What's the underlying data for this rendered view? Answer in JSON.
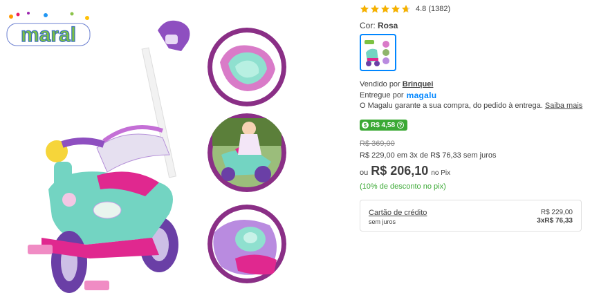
{
  "brand_logo": {
    "text": "maral"
  },
  "product": {
    "rating": {
      "value": "4.8",
      "count": "(1382)",
      "stars": 4.8
    },
    "color": {
      "label": "Cor:",
      "value": "Rosa"
    },
    "seller": {
      "prefix": "Vendido por",
      "name": "Brinquei"
    },
    "delivery": {
      "prefix": "Entregue por",
      "brand": "magalu"
    },
    "guarantee": {
      "text": "O Magalu garante a sua compra, do pedido à entrega.",
      "link": "Saiba mais"
    },
    "cashback": {
      "icon": "$",
      "value": "R$ 4,58",
      "info_icon": "?"
    },
    "price": {
      "old": "R$ 369,00",
      "installment": "R$ 229,00 em 3x de R$ 76,33 sem juros",
      "pix_prefix": "ou",
      "pix_value": "R$ 206,10",
      "pix_suffix": "no Pix",
      "pix_discount": "(10% de desconto no pix)"
    },
    "payment_option": {
      "title": "Cartão de crédito",
      "subtitle": "sem juros",
      "total": "R$ 229,00",
      "installments": "3xR$ 76,33"
    }
  },
  "colors": {
    "accent_blue": "#0086ff",
    "green": "#3ba935",
    "star": "#f5b100"
  }
}
